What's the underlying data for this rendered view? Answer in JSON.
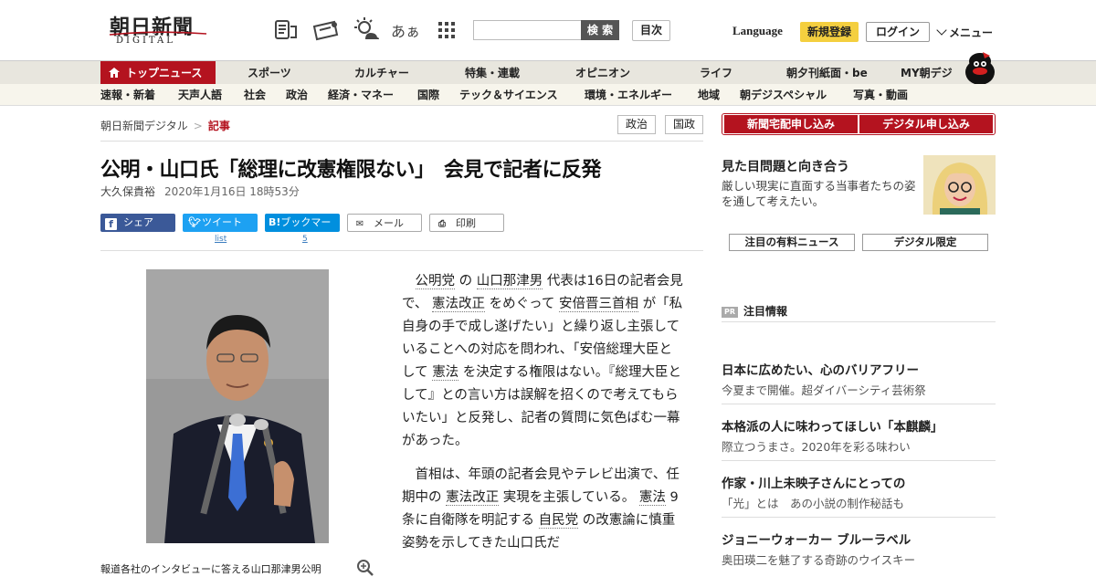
{
  "header": {
    "logo_main": "朝日新聞",
    "logo_sub": "DIGITAL",
    "icons": [
      "newspaper-icon",
      "ticket-icon",
      "weather-icon",
      "font-size-icon",
      "grid-icon"
    ],
    "font_size_label": "あぁ",
    "search_placeholder": "",
    "search_button": "検 索",
    "toc_button": "目次",
    "language": "Language",
    "register": "新規登録",
    "login": "ログイン",
    "menu": "メニュー"
  },
  "nav_primary": {
    "top": "トップニュース",
    "items": [
      "スポーツ",
      "カルチャー",
      "特集・連載",
      "オピニオン",
      "ライフ",
      "朝夕刊紙面・be",
      "MY朝デジ"
    ]
  },
  "nav_secondary": {
    "items": [
      "速報・新着",
      "天声人語",
      "社会",
      "政治",
      "経済・マネー",
      "国際",
      "テック＆サイエンス",
      "環境・エネルギー",
      "地域",
      "朝デジスペシャル",
      "写真・動画"
    ]
  },
  "breadcrumb": {
    "home": "朝日新聞デジタル",
    "separator": ">",
    "current": "記事"
  },
  "tags": [
    "政治",
    "国政"
  ],
  "article": {
    "headline": "公明・山口氏「総理に改憲権限ない」　会見で記者に反発",
    "author": "大久保貴裕",
    "date": "2020年1月16日 18時53分",
    "share": {
      "facebook": "シェア",
      "twitter": "ツイート",
      "twitter_count": "list",
      "hatena": "ブックマーク",
      "hatena_count": "5",
      "mail": "メール",
      "print": "印刷"
    },
    "caption": "報道各社のインタビューに答える山口那津男公明",
    "p1": {
      "t1": "公明党",
      "t2": " の ",
      "t3": "山口那津男",
      "t4": " 代表は16日の記者会見で、 ",
      "t5": "憲法改正",
      "t6": " をめぐって ",
      "t7": "安倍晋三首相",
      "t8": " が「私自身の手で成し遂げたい」と繰り返し主張していることへの対応を問われ、「安倍総理大臣として ",
      "t9": "憲法",
      "t10": " を決定する権限はない。『総理大臣として』との言い方は誤解を招くので考えてもらいたい」と反発し、記者の質問に気色ばむ一幕があった。"
    },
    "p2": {
      "t1": "首相は、年頭の記者会見やテレビ出演で、任期中の ",
      "t2": "憲法改正",
      "t3": " 実現を主張している。 ",
      "t4": "憲法",
      "t5": " 9条に自衛隊を明記する ",
      "t6": "自民党",
      "t7": " の改憲論に慎重姿勢を示してきた山口氏だ"
    }
  },
  "sidebar": {
    "subscribe_paper": "新聞宅配申し込み",
    "subscribe_digital": "デジタル申し込み",
    "promo_title": "見た目問題と向き合う",
    "promo_text": "厳しい現実に直面する当事者たちの姿を通して考えたい。",
    "tab_paid": "注目の有料ニュース",
    "tab_digital": "デジタル限定",
    "pr_badge": "PR",
    "pr_label": "注目情報",
    "items": [
      {
        "title": "日本に広めたい、心のバリアフリー",
        "sub": "今夏まで開催。超ダイバーシティ芸術祭"
      },
      {
        "title": "本格派の人に味わってほしい「本麒麟」",
        "sub": "際立つうまさ。2020年を彩る味わい"
      },
      {
        "title": "作家・川上未映子さんにとっての",
        "sub": "「光」とは　あの小説の制作秘話も"
      },
      {
        "title": "ジョニーウォーカー ブルーラベル",
        "sub": "奥田瑛二を魅了する奇跡のウイスキー"
      }
    ]
  },
  "colors": {
    "brand_red": "#b4131f",
    "register_yellow": "#f4cf3f",
    "facebook": "#3b5998",
    "twitter": "#1da1f2",
    "hatena": "#008fde"
  }
}
